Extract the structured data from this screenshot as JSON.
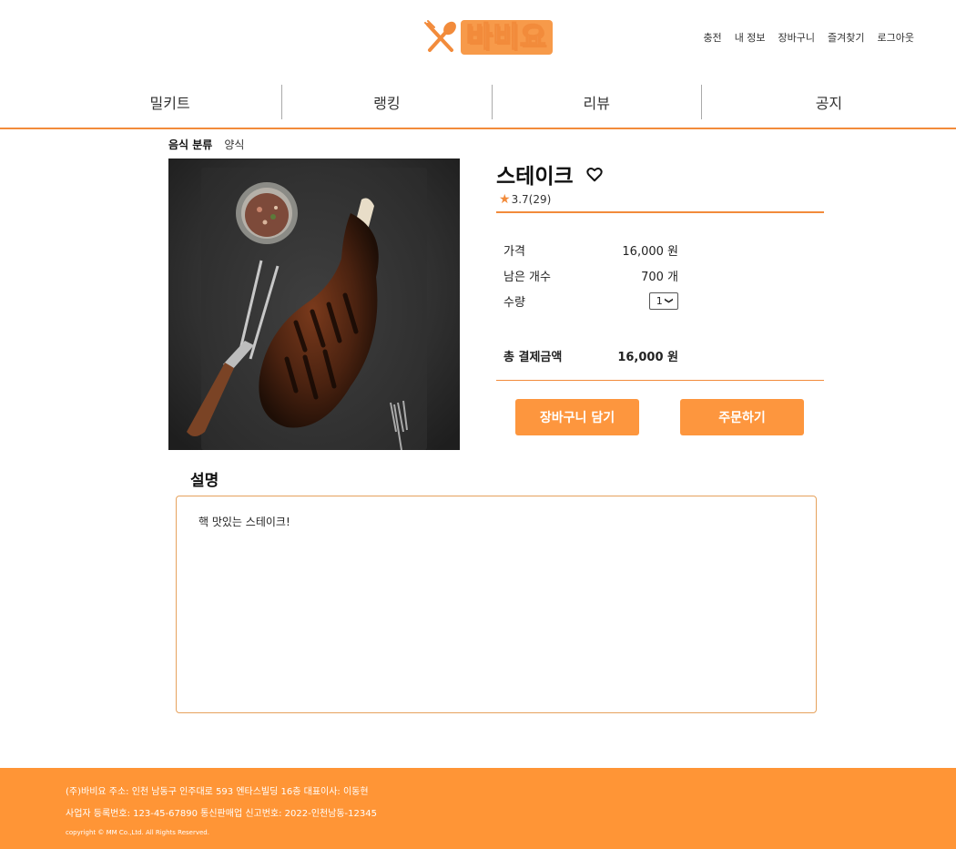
{
  "header": {
    "logo_text": "바비요",
    "top_menu": [
      "충전",
      "내 정보",
      "장바구니",
      "즐겨찾기",
      "로그아웃"
    ]
  },
  "nav": {
    "items": [
      "밀키트",
      "랭킹",
      "리뷰",
      "공지"
    ]
  },
  "category": {
    "label": "음식 분류",
    "value": "양식"
  },
  "product": {
    "name": "스테이크",
    "rating": "3.7(29)",
    "price_label": "가격",
    "price_value": "16,000 원",
    "stock_label": "남은 개수",
    "stock_value": "700 개",
    "qty_label": "수량",
    "qty_value": "1",
    "total_label": "총 결제금액",
    "total_value": "16,000 원",
    "cart_button": "장바구니 담기",
    "order_button": "주문하기"
  },
  "description": {
    "title": "설명",
    "text": "핵 맛있는 스테이크!"
  },
  "footer": {
    "line1": "(주)바비요  주소: 인천 남동구 인주대로 593 엔타스빌딩 16층  대표이사: 이동현",
    "line2": "사업자 등록번호: 123-45-67890  통신판매업 신고번호: 2022-인천남동-12345",
    "line3": "copyright © MM Co.,Ltd. All Rights Reserved."
  },
  "colors": {
    "accent": "#f28b3b",
    "button": "#fd963e",
    "footer": "#ff9536"
  }
}
